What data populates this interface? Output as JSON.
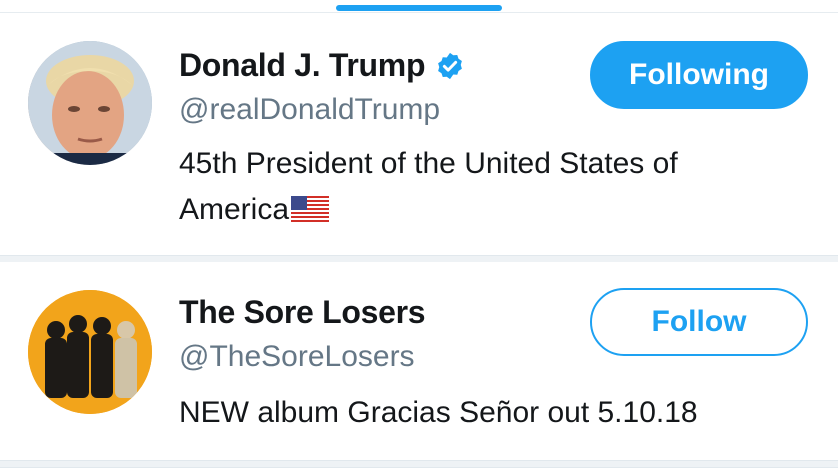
{
  "accent_color": "#1da1f2",
  "users": [
    {
      "name": "Donald J. Trump",
      "verified": true,
      "handle": "@realDonaldTrump",
      "bio": "45th President of the United States of America",
      "bio_emoji": "us-flag",
      "button_label": "Following",
      "button_state": "following"
    },
    {
      "name": "The Sore Losers",
      "verified": false,
      "handle": "@TheSoreLosers",
      "bio": "NEW album Gracias Señor out 5.10.18",
      "button_label": "Follow",
      "button_state": "follow"
    }
  ]
}
